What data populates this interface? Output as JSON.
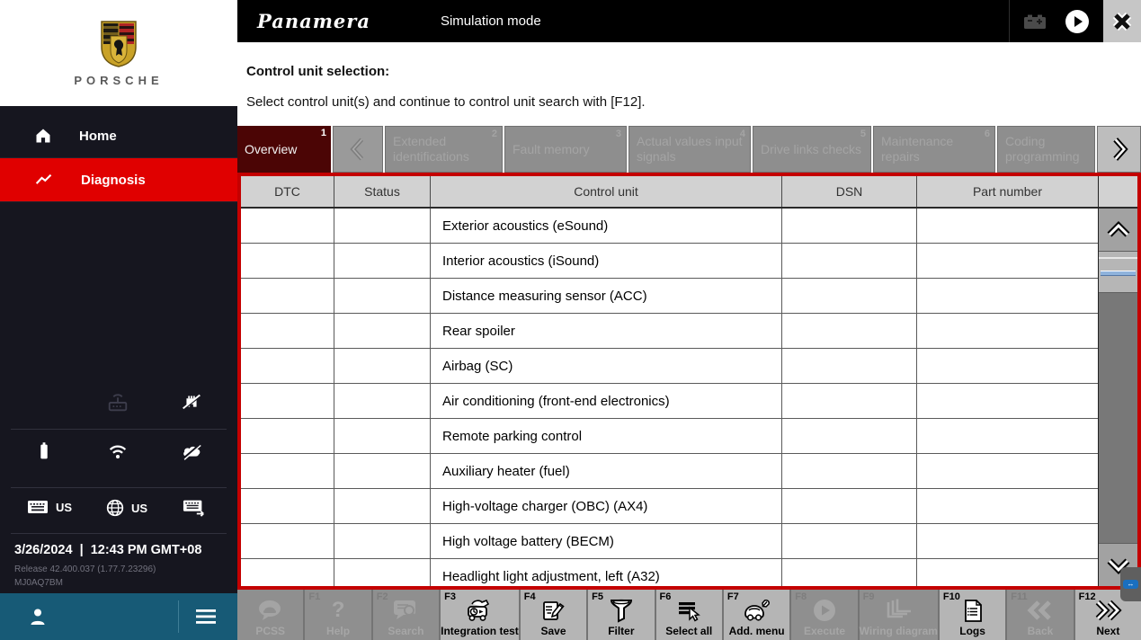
{
  "topbar": {
    "model": "Panamera",
    "mode": "Simulation mode",
    "icons": [
      "battery-icon",
      "play-icon",
      "close-icon"
    ]
  },
  "page": {
    "title": "Control unit selection:",
    "subtitle": "Select control unit(s) and continue to control unit search with [F12]."
  },
  "tabs": [
    {
      "label": "Overview",
      "badge": "1",
      "state": "active"
    },
    {
      "label": "Extended identifications",
      "badge": "2",
      "state": "disabled"
    },
    {
      "label": "Fault memory",
      "badge": "3",
      "state": "disabled"
    },
    {
      "label": "Actual values input signals",
      "badge": "4",
      "state": "disabled"
    },
    {
      "label": "Drive links checks",
      "badge": "5",
      "state": "disabled"
    },
    {
      "label": "Maintenance repairs",
      "badge": "6",
      "state": "disabled"
    },
    {
      "label": "Coding programming",
      "badge": "",
      "state": "disabled"
    }
  ],
  "table": {
    "columns": [
      "DTC",
      "Status",
      "Control unit",
      "DSN",
      "Part number"
    ],
    "rows": [
      {
        "control_unit": "Exterior acoustics (eSound)"
      },
      {
        "control_unit": "Interior acoustics (iSound)"
      },
      {
        "control_unit": "Distance measuring sensor (ACC)"
      },
      {
        "control_unit": "Rear spoiler"
      },
      {
        "control_unit": "Airbag (SC)"
      },
      {
        "control_unit": "Air conditioning (front-end electronics)"
      },
      {
        "control_unit": "Remote parking control"
      },
      {
        "control_unit": "Auxiliary heater (fuel)"
      },
      {
        "control_unit": "High-voltage charger (OBC) (AX4)"
      },
      {
        "control_unit": "High voltage battery (BECM)"
      },
      {
        "control_unit": "Headlight light adjustment, left (A32)"
      }
    ]
  },
  "toolbar": {
    "buttons": [
      {
        "fkey": "",
        "label": "PCSS",
        "enabled": false,
        "icon": "pcss-chat-icon"
      },
      {
        "fkey": "F1",
        "label": "Help",
        "enabled": false,
        "icon": "help-icon"
      },
      {
        "fkey": "F2",
        "label": "Search",
        "enabled": false,
        "icon": "search-bubble-icon"
      },
      {
        "fkey": "F3",
        "label": "Integration test",
        "enabled": true,
        "icon": "integration-test-icon"
      },
      {
        "fkey": "F4",
        "label": "Save",
        "enabled": true,
        "icon": "save-doc-pencil-icon"
      },
      {
        "fkey": "F5",
        "label": "Filter",
        "enabled": true,
        "icon": "funnel-icon"
      },
      {
        "fkey": "F6",
        "label": "Select all",
        "enabled": true,
        "icon": "select-all-icon"
      },
      {
        "fkey": "F7",
        "label": "Add. menu",
        "enabled": true,
        "icon": "car-menu-icon"
      },
      {
        "fkey": "F8",
        "label": "Execute",
        "enabled": false,
        "icon": "play-circle-icon"
      },
      {
        "fkey": "F9",
        "label": "Wiring diagram",
        "enabled": false,
        "icon": "wiring-diagram-icon"
      },
      {
        "fkey": "F10",
        "label": "Logs",
        "enabled": true,
        "icon": "logs-doc-icon"
      },
      {
        "fkey": "F11",
        "label": "Back",
        "enabled": false,
        "icon": "double-chevron-left-icon"
      },
      {
        "fkey": "F12",
        "label": "Next",
        "enabled": true,
        "icon": "double-chevron-right-icon"
      }
    ]
  },
  "sidebar": {
    "brand": "PORSCHE",
    "nav": [
      {
        "label": "Home",
        "icon": "home-icon",
        "active": false
      },
      {
        "label": "Diagnosis",
        "icon": "diagnosis-pulse-icon",
        "active": true
      }
    ],
    "status_icons": [
      "vci-router-icon",
      "ethernet-disconnected-icon",
      "battery-icon",
      "wifi-icon",
      "cloud-offline-icon"
    ],
    "locale": {
      "keyboard_label": "US",
      "language_label": "US",
      "input_switch_icon": "keyboard-switch-icon"
    },
    "date": "3/26/2024",
    "separator": "|",
    "time": "12:43 PM GMT+08",
    "release_line": "Release 42.400.037 (1.77.7.23296)",
    "build_code": "MJ0AQ7BM"
  },
  "colors": {
    "accent_red": "#e00000",
    "frame_red": "#c40000",
    "active_tab_maroon": "#4b0505",
    "sidebar_bg": "#16161f",
    "teal_bar": "#175a76",
    "disabled_gray": "#8e8e8e",
    "enabled_gray": "#b5b5b5"
  }
}
